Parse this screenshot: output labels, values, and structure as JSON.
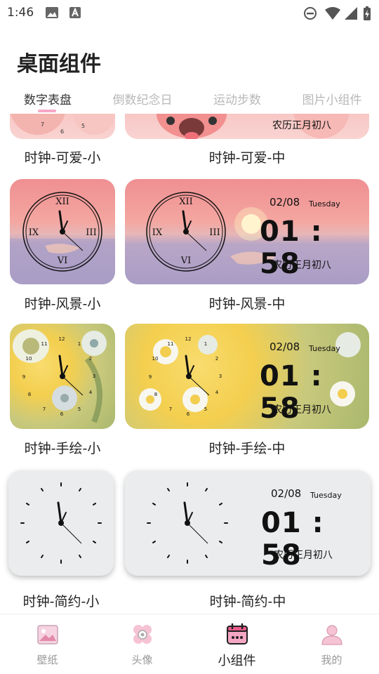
{
  "status_bar": {
    "time": "1:46"
  },
  "header": {
    "title": "桌面组件"
  },
  "tabs": [
    {
      "label": "数字表盘",
      "active": true
    },
    {
      "label": "倒数纪念日",
      "active": false
    },
    {
      "label": "运动步数",
      "active": false
    },
    {
      "label": "图片小组件",
      "active": false
    }
  ],
  "widgets": {
    "cute_small": {
      "label": "时钟-可爱-小"
    },
    "cute_medium": {
      "label": "时钟-可爱-中",
      "lunar": "农历正月初八"
    },
    "scene_small": {
      "label": "时钟-风景-小",
      "numerals": [
        "XII",
        "III",
        "VI",
        "IX"
      ]
    },
    "scene_medium": {
      "label": "时钟-风景-中",
      "date": "02/08",
      "weekday": "Tuesday",
      "time": "01 : 58",
      "lunar": "农历正月初八",
      "numerals": [
        "XII",
        "III",
        "VI",
        "IX"
      ]
    },
    "flower_small": {
      "label": "时钟-手绘-小",
      "numerals": [
        "12",
        "1",
        "2",
        "3",
        "4",
        "5",
        "6",
        "7",
        "8",
        "9",
        "10",
        "11"
      ]
    },
    "flower_medium": {
      "label": "时钟-手绘-中",
      "date": "02/08",
      "weekday": "Tuesday",
      "time": "01 : 58",
      "lunar": "农历正月初八",
      "numerals": [
        "12",
        "1",
        "2",
        "3",
        "4",
        "5",
        "6",
        "7",
        "8",
        "9",
        "10",
        "11"
      ]
    },
    "simple_small": {
      "label": "时钟-简约-小"
    },
    "simple_medium": {
      "label": "时钟-简约-中",
      "date": "02/08",
      "weekday": "Tuesday",
      "time": "01 : 58",
      "lunar": "农历正月初八"
    }
  },
  "bottom_nav": [
    {
      "label": "壁纸",
      "icon": "wallpaper-icon",
      "active": false
    },
    {
      "label": "头像",
      "icon": "avatar-icon",
      "active": false
    },
    {
      "label": "小组件",
      "icon": "widget-calendar-icon",
      "active": true
    },
    {
      "label": "我的",
      "icon": "profile-icon",
      "active": false
    }
  ],
  "colors": {
    "accent": "#f6a8c6",
    "nav_active": "#e95b8a"
  }
}
